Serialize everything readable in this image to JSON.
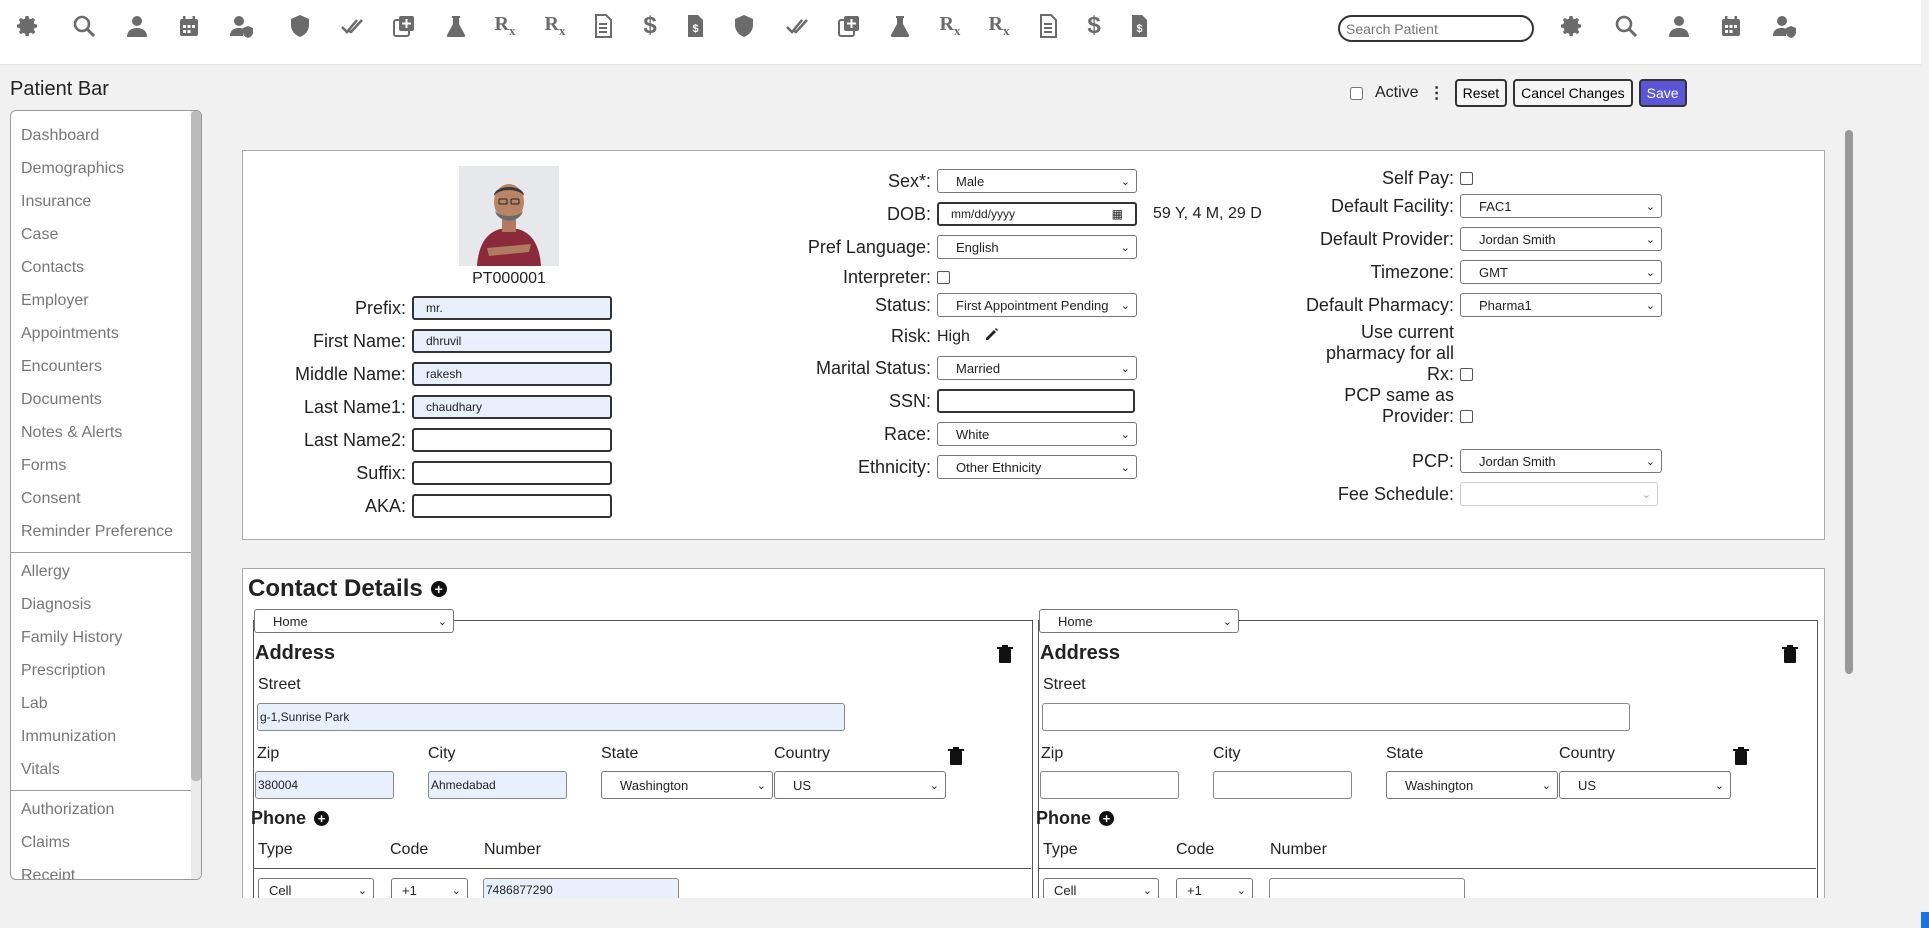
{
  "topbar": {
    "icons": [
      "gear-icon",
      "search-icon",
      "user-icon",
      "calendar-icon",
      "user-shield-icon",
      "shield-icon",
      "double-check-icon",
      "add-copy-icon",
      "flask-icon",
      "rx-icon",
      "rx-icon",
      "document-icon",
      "dollar-icon",
      "invoice-icon",
      "shield-icon",
      "double-check-icon",
      "add-copy-icon",
      "flask-icon",
      "rx-icon",
      "rx-icon",
      "document-icon",
      "dollar-icon",
      "invoice-icon"
    ],
    "search_placeholder": "Search Patient",
    "right_icons": [
      "gear-icon",
      "search-icon",
      "user-icon",
      "calendar-icon",
      "user-shield-icon"
    ]
  },
  "page_title": "Patient Bar",
  "header": {
    "active_label": "Active",
    "active_checked": false,
    "reset_label": "Reset",
    "cancel_label": "Cancel Changes",
    "save_label": "Save"
  },
  "sidebar": {
    "group1": [
      "Dashboard",
      "Demographics",
      "Insurance",
      "Case",
      "Contacts",
      "Employer",
      "Appointments",
      "Encounters",
      "Documents",
      "Notes & Alerts",
      "Forms",
      "Consent",
      "Reminder Preference"
    ],
    "group2": [
      "Allergy",
      "Diagnosis",
      "Family History",
      "Prescription",
      "Lab",
      "Immunization",
      "Vitals"
    ],
    "group3": [
      "Authorization",
      "Claims",
      "Receipt"
    ]
  },
  "patient": {
    "id": "PT000001",
    "prefix_label": "Prefix:",
    "prefix": "mr.",
    "first_label": "First Name:",
    "first": "dhruvil",
    "middle_label": "Middle Name:",
    "middle": "rakesh",
    "last1_label": "Last Name1:",
    "last1": "chaudhary",
    "last2_label": "Last Name2:",
    "last2": "",
    "suffix_label": "Suffix:",
    "suffix": "",
    "aka_label": "AKA:",
    "aka": ""
  },
  "demographics": {
    "sex_label": "Sex*:",
    "sex": "Male",
    "dob_label": "DOB:",
    "dob_placeholder": "mm/dd/yyyy",
    "age": "59 Y, 4 M, 29 D",
    "lang_label": "Pref Language:",
    "lang": "English",
    "interpreter_label": "Interpreter:",
    "status_label": "Status:",
    "status": "First Appointment Pending",
    "risk_label": "Risk:",
    "risk": "High",
    "marital_label": "Marital Status:",
    "marital": "Married",
    "ssn_label": "SSN:",
    "ssn": "",
    "race_label": "Race:",
    "race": "White",
    "ethnicity_label": "Ethnicity:",
    "ethnicity": "Other Ethnicity"
  },
  "preferences": {
    "selfpay_label": "Self Pay:",
    "facility_label": "Default Facility:",
    "facility": "FAC1",
    "provider_label": "Default Provider:",
    "provider": "Jordan Smith",
    "timezone_label": "Timezone:",
    "timezone": "GMT",
    "pharmacy_label": "Default Pharmacy:",
    "pharmacy": "Pharma1",
    "use_pharmacy_l1": "Use current",
    "use_pharmacy_l2": "pharmacy for all",
    "use_pharmacy_l3": "Rx:",
    "pcp_same_l1": "PCP same as",
    "pcp_same_l2": "Provider:",
    "pcp_label": "PCP:",
    "pcp": "Jordan Smith",
    "fee_label": "Fee Schedule:",
    "fee": ""
  },
  "contact": {
    "title": "Contact Details",
    "left": {
      "type": "Home",
      "address_title": "Address",
      "street_label": "Street",
      "street": "g-1,Sunrise Park",
      "zip_label": "Zip",
      "zip": "380004",
      "city_label": "City",
      "city": "Ahmedabad",
      "state_label": "State",
      "state": "Washington",
      "country_label": "Country",
      "country": "US",
      "phone_title": "Phone",
      "type_label": "Type",
      "code_label": "Code",
      "number_label": "Number",
      "phone_type": "Cell",
      "phone_code": "+1",
      "phone_number": "7486877290"
    },
    "right": {
      "type": "Home",
      "address_title": "Address",
      "street_label": "Street",
      "street": "",
      "zip_label": "Zip",
      "zip": "",
      "city_label": "City",
      "city": "",
      "state_label": "State",
      "state": "Washington",
      "country_label": "Country",
      "country": "US",
      "phone_title": "Phone",
      "type_label": "Type",
      "code_label": "Code",
      "number_label": "Number",
      "phone_type": "Cell",
      "phone_code": "+1",
      "phone_number": ""
    }
  },
  "colors": {
    "save_button": "#5b56d6",
    "icon_gray": "#6b6b6b",
    "filled_input": "#e8f0fe"
  }
}
